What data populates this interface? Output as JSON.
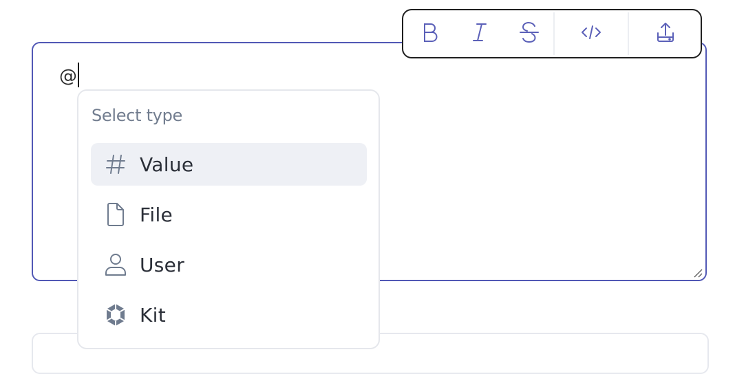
{
  "editor": {
    "text": "@",
    "resize_handle_icon": "resize-grip-icon"
  },
  "toolbar": {
    "buttons": [
      {
        "name": "bold",
        "icon": "bold-icon"
      },
      {
        "name": "italic",
        "icon": "italic-icon"
      },
      {
        "name": "strikethrough",
        "icon": "strikethrough-icon"
      },
      {
        "name": "code",
        "icon": "code-icon"
      },
      {
        "name": "upload",
        "icon": "upload-icon"
      }
    ]
  },
  "dropdown": {
    "title": "Select type",
    "items": [
      {
        "label": "Value",
        "icon": "hash-icon",
        "active": true
      },
      {
        "label": "File",
        "icon": "file-icon",
        "active": false
      },
      {
        "label": "User",
        "icon": "user-icon",
        "active": false
      },
      {
        "label": "Kit",
        "icon": "kit-icon",
        "active": false
      }
    ]
  },
  "colors": {
    "accent": "#5158b5",
    "toolbar_icon": "#5b60b8",
    "menu_icon": "#6f7b8e",
    "active_item_bg": "#eef0f5"
  }
}
